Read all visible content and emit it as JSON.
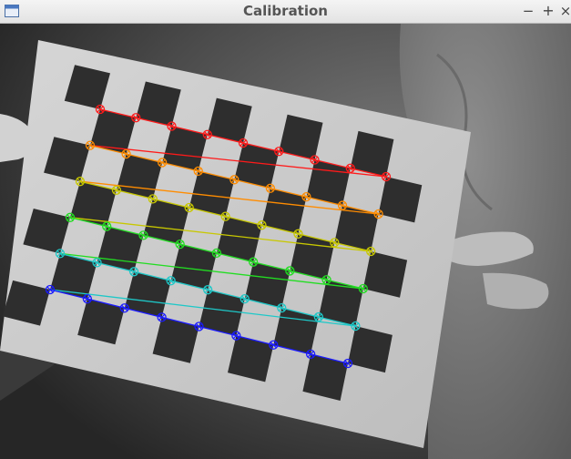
{
  "window": {
    "title": "Calibration",
    "icons": {
      "app": "window-app-icon",
      "minimize": "minimize-icon",
      "maximize": "maximize-icon",
      "close": "close-icon"
    },
    "controls": {
      "minimize": "−",
      "maximize": "+",
      "close": "×"
    }
  },
  "calibration": {
    "pattern": "chessboard",
    "board_rows": 6,
    "corners_per_row": 9,
    "row_colors": [
      "#ff1a1a",
      "#ff8c00",
      "#c8c800",
      "#22dd22",
      "#1ec8c8",
      "#1a1aff"
    ]
  }
}
